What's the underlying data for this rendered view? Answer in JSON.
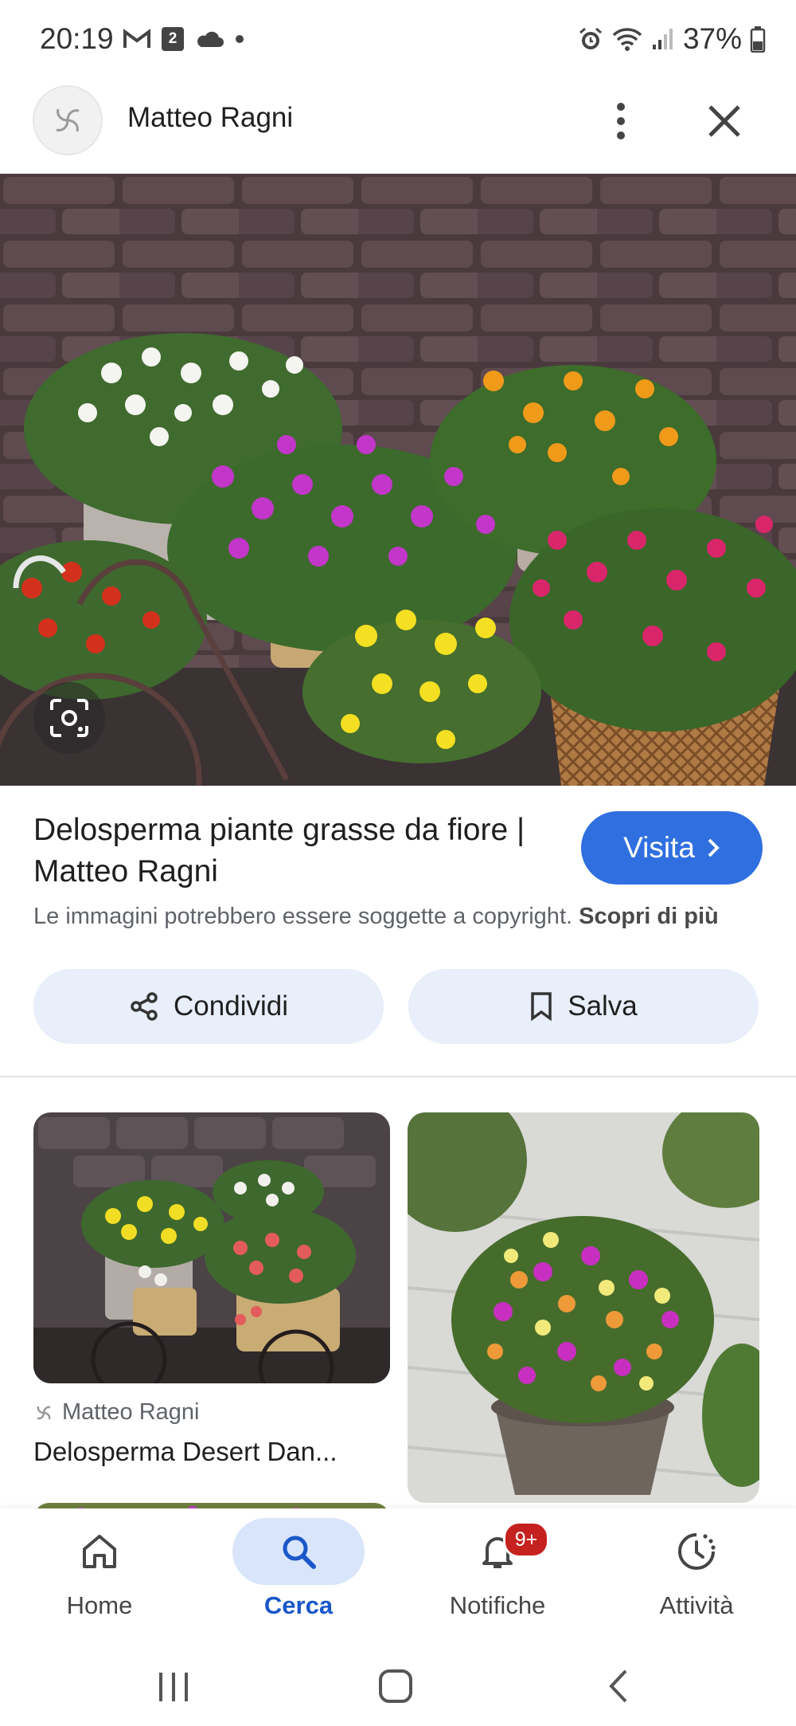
{
  "status_bar": {
    "time": "20:19",
    "left_icons": [
      "gmail-icon",
      "calendar-icon",
      "cloud-icon",
      "dot-icon"
    ],
    "calendar_day": "2",
    "right_icons": [
      "alarm-icon",
      "wifi-icon",
      "signal-icon",
      "battery-icon"
    ],
    "battery": "37%"
  },
  "header": {
    "source_name": "Matteo Ragni",
    "more_icon": "more-vert-icon",
    "close_icon": "close-icon"
  },
  "result": {
    "title": "Delosperma piante grasse da fiore | Matteo Ragni",
    "visit_label": "Visita",
    "copyright_text": "Le immagini potrebbero essere soggette a copyright.",
    "learn_more": "Scopri di più",
    "share_label": "Condividi",
    "save_label": "Salva"
  },
  "related": [
    {
      "source": "Matteo Ragni",
      "title": "Delosperma Desert Dan..."
    }
  ],
  "bottom_nav": [
    {
      "label": "Home",
      "icon": "home-icon"
    },
    {
      "label": "Cerca",
      "icon": "search-icon",
      "active": true
    },
    {
      "label": "Notifiche",
      "icon": "bell-icon",
      "badge": "9+"
    },
    {
      "label": "Attività",
      "icon": "activity-icon"
    }
  ],
  "colors": {
    "accent": "#2f6fe0",
    "chip_bg": "#e8eefa",
    "active_nav_bg": "#d9e5fb",
    "badge": "#c5221f"
  }
}
